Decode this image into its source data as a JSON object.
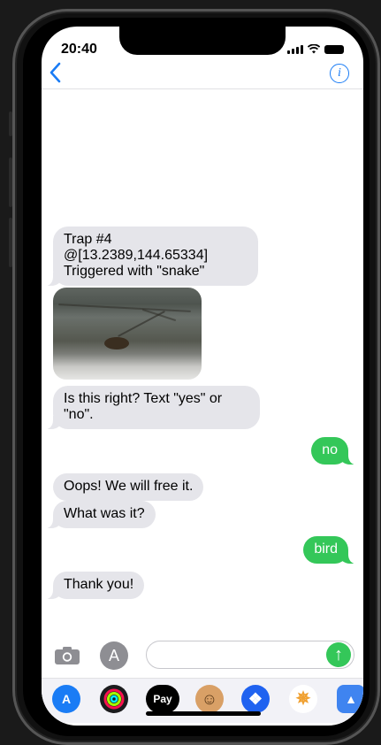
{
  "status": {
    "time": "20:40"
  },
  "nav": {
    "back_icon": "chevron-left-icon",
    "info_icon": "info-icon",
    "back_glyph": "‹",
    "info_glyph": "i"
  },
  "messages": [
    {
      "from": "them",
      "lines": [
        "Trap #4",
        "@[13.2389,144.65334]",
        "Triggered with \"snake\""
      ]
    },
    {
      "from": "them",
      "type": "photo"
    },
    {
      "from": "them",
      "lines": [
        "Is this right? Text \"yes\" or",
        "\"no\"."
      ]
    },
    {
      "from": "me",
      "text": "no"
    },
    {
      "from": "them",
      "text": "Oops! We will free it."
    },
    {
      "from": "them",
      "text": "What was it?"
    },
    {
      "from": "me",
      "text": "bird"
    },
    {
      "from": "them",
      "text": "Thank you!"
    }
  ],
  "composer": {
    "placeholder": "",
    "value": "",
    "send_glyph": "↑",
    "apps_glyph": "A"
  },
  "apps": [
    {
      "name": "app-store-icon",
      "glyph": "A",
      "color": "#1a7cf5"
    },
    {
      "name": "activity-icon",
      "glyph": "◎",
      "color": "#1c1c1e"
    },
    {
      "name": "apple-pay-icon",
      "glyph": "Pay",
      "color": "#000000"
    },
    {
      "name": "monkey-icon",
      "glyph": "☺",
      "color": "#d9a066"
    },
    {
      "name": "dropbox-icon",
      "glyph": "❖",
      "color": "#1f62f0"
    },
    {
      "name": "pinwheel-icon",
      "glyph": "✵",
      "color": "#f0a030"
    },
    {
      "name": "more-app-icon",
      "glyph": "▲",
      "color": "#3f84f0"
    }
  ],
  "colors": {
    "accent": "#1a7cf5",
    "outgoing": "#34c759",
    "incoming": "#e5e5ea"
  }
}
